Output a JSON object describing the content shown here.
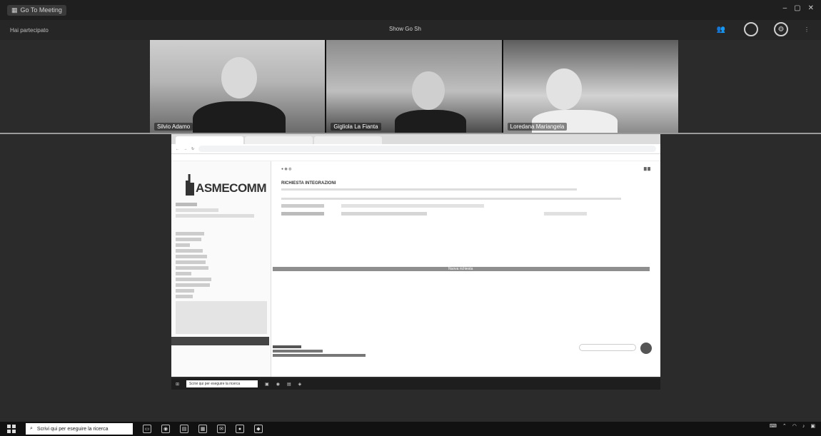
{
  "meeting": {
    "app_title": "Go To Meeting",
    "session_label": "Hai partecipato",
    "viewer_label": "Show Go Sh",
    "participants": [
      {
        "name": "Silvio Adamo"
      },
      {
        "name": "Gigliola La Fianta"
      },
      {
        "name": "Loredana Mariangela"
      }
    ]
  },
  "shared_screen": {
    "site_logo": "ASMECOMM",
    "page_title": "RICHIESTA INTEGRAZIONI",
    "bar_label": "Nuova richiesta",
    "inner_search_placeholder": "Scrivi qui per eseguire la ricerca"
  },
  "taskbar": {
    "search_placeholder": "Scrivi qui per eseguire la ricerca"
  }
}
